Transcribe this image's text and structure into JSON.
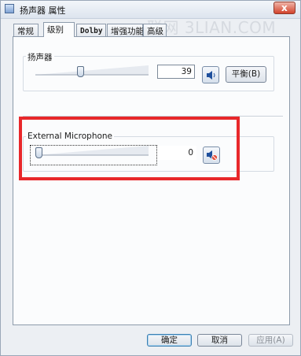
{
  "window": {
    "title": "扬声器 属性",
    "close_label": "x"
  },
  "watermark": "联网 3LIAN.COM",
  "tabs": [
    {
      "label": "常规",
      "active": false
    },
    {
      "label": "级别",
      "active": true
    },
    {
      "label": "Dolby",
      "active": false
    },
    {
      "label": "增强功能",
      "active": false
    },
    {
      "label": "高级",
      "active": false
    }
  ],
  "speaker_group": {
    "label": "扬声器",
    "value": "39",
    "level_percent": 39,
    "balance_button": "平衡(B)",
    "icon": "speaker-volume-icon"
  },
  "microphone_group": {
    "label": "External Microphone",
    "value": "0",
    "level_percent": 0,
    "icon": "speaker-muted-icon",
    "muted": true
  },
  "highlight_color": "#e8282b",
  "buttons": {
    "ok": "确定",
    "cancel": "取消",
    "apply": "应用(A)"
  }
}
